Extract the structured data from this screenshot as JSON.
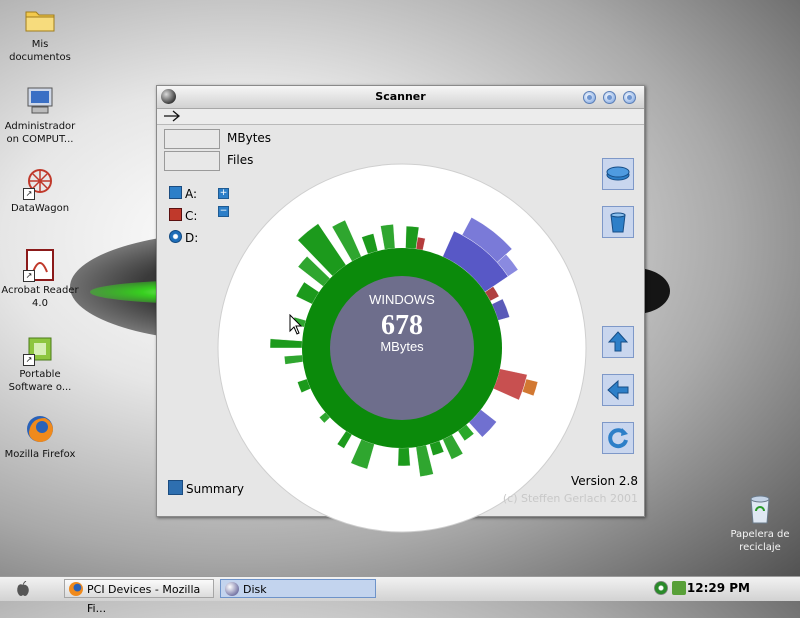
{
  "desktop": {
    "icons": [
      {
        "label": "Mis documentos",
        "icon": "folder-icon"
      },
      {
        "label": "Administrador on COMPUT...",
        "icon": "computer-icon"
      },
      {
        "label": "DataWagon",
        "icon": "datawagon-icon"
      },
      {
        "label": "Acrobat Reader 4.0",
        "icon": "acrobat-icon"
      },
      {
        "label": "Portable Software o...",
        "icon": "portable-software-icon"
      },
      {
        "label": "Mozilla Firefox",
        "icon": "firefox-icon"
      },
      {
        "label": "Papelera de reciclaje",
        "icon": "recycle-bin-icon"
      }
    ]
  },
  "window": {
    "title": "Scanner",
    "toolbar_icon": "arrow-right-icon",
    "size_unit": "MBytes",
    "files_label": "Files",
    "drives": [
      {
        "label": "A:",
        "icon": "floppy-icon"
      },
      {
        "label": "C:",
        "icon": "hard-disk-icon"
      },
      {
        "label": "D:",
        "icon": "cdrom-icon"
      }
    ],
    "zoom_plus": "+",
    "zoom_minus": "−",
    "center": {
      "name": "WINDOWS",
      "value": "678",
      "unit": "MBytes"
    },
    "side_buttons": [
      "disk-icon",
      "trash-icon",
      "up-arrow-icon",
      "back-arrow-icon",
      "refresh-icon"
    ],
    "summary_label": "Summary",
    "version": "Version 2.8",
    "copyright": "(c) Steffen Gerlach 2001",
    "colors": {
      "disc": "#6e6e8c",
      "ring": "#0b8a0b",
      "blue": "#6464d2",
      "red": "#b43c3c",
      "orange": "#d27832"
    }
  },
  "taskbar": {
    "tasks": [
      {
        "label": "PCI Devices - Mozilla Fi...",
        "icon": "firefox-icon"
      },
      {
        "label": "Disk",
        "icon": "disk-ball-icon"
      }
    ],
    "clock": "12:29 PM"
  }
}
